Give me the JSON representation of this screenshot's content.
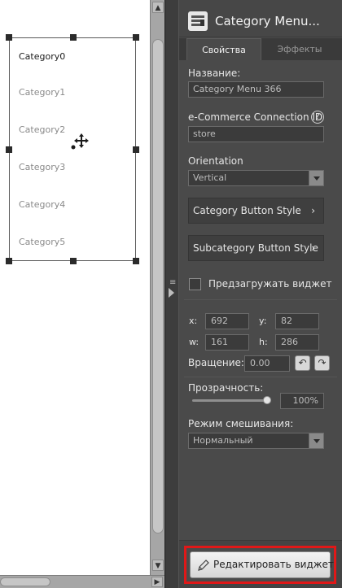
{
  "canvas": {
    "categories": [
      "Category0",
      "Category1",
      "Category2",
      "Category3",
      "Category4",
      "Category5"
    ]
  },
  "panel": {
    "title": "Category Menu...",
    "tabs": [
      "Свойства",
      "Эффекты"
    ],
    "name_label": "Название:",
    "name_value": "Category Menu 366",
    "connection_label": "e-Commerce Connection ID",
    "connection_value": "store",
    "orientation_label": "Orientation",
    "orientation_value": "Vertical",
    "category_button_style": "Category Button Style",
    "subcategory_button_style": "Subcategory Button Style",
    "preload_label": "Предзагружать виджет",
    "preload_checked": false,
    "x_label": "x:",
    "x_value": "692",
    "y_label": "y:",
    "y_value": "82",
    "w_label": "w:",
    "w_value": "161",
    "h_label": "h:",
    "h_value": "286",
    "rotation_label": "Вращение:",
    "rotation_value": "0.00",
    "opacity_label": "Прозрачность:",
    "opacity_value": "100%",
    "opacity_fraction": 1.0,
    "blend_label": "Режим смешивания:",
    "blend_value": "Нормальный",
    "edit_widget_label": "Редактировать виджет"
  },
  "colors": {
    "panel_bg": "#4a4a4a",
    "highlight": "#e01818"
  },
  "icons": [
    "category-menu-icon",
    "help-icon",
    "move-icon",
    "pencil-icon",
    "rotate-left-icon",
    "rotate-right-icon",
    "chevron-right-icon",
    "chevron-down-icon"
  ]
}
